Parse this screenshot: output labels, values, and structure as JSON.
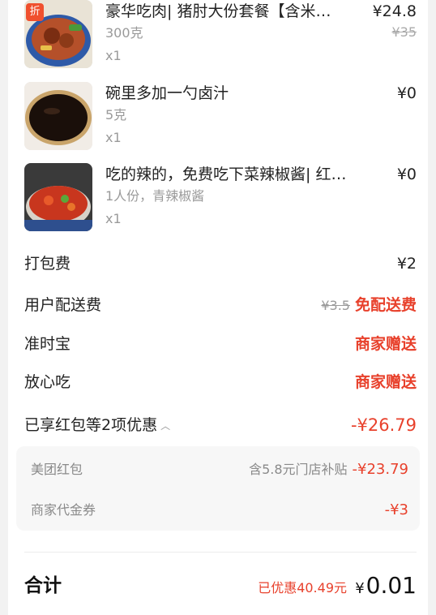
{
  "items": [
    {
      "name": "豪华吃肉| 猪肘大份套餐【含米…",
      "spec": "300克",
      "qty": "x1",
      "price": "¥24.8",
      "orig_price": "¥35",
      "tag": "折"
    },
    {
      "name": "碗里多加一勺卤汁",
      "spec": "5克",
      "qty": "x1",
      "price": "¥0"
    },
    {
      "name": "吃的辣的，免费吃下菜辣椒酱| 红剁…",
      "spec": "1人份，青辣椒酱",
      "qty": "x1",
      "price": "¥0"
    }
  ],
  "fees": {
    "packing_label": "打包费",
    "packing_value": "¥2",
    "delivery_label": "用户配送费",
    "delivery_orig": "¥3.5",
    "delivery_value": "免配送费",
    "ontime_label": "准时宝",
    "ontime_value": "商家赠送",
    "safe_label": "放心吃",
    "safe_value": "商家赠送"
  },
  "discounts": {
    "summary_label": "已享红包等2项优惠",
    "summary_value": "-¥26.79",
    "redpacket_label": "美团红包",
    "redpacket_note": "含5.8元门店补贴",
    "redpacket_value": "-¥23.79",
    "voucher_label": "商家代金券",
    "voucher_value": "-¥3"
  },
  "total": {
    "label": "合计",
    "saved": "已优惠40.49元",
    "currency": "¥",
    "amount": "0.01"
  },
  "colors": {
    "accent": "#e8412c"
  }
}
